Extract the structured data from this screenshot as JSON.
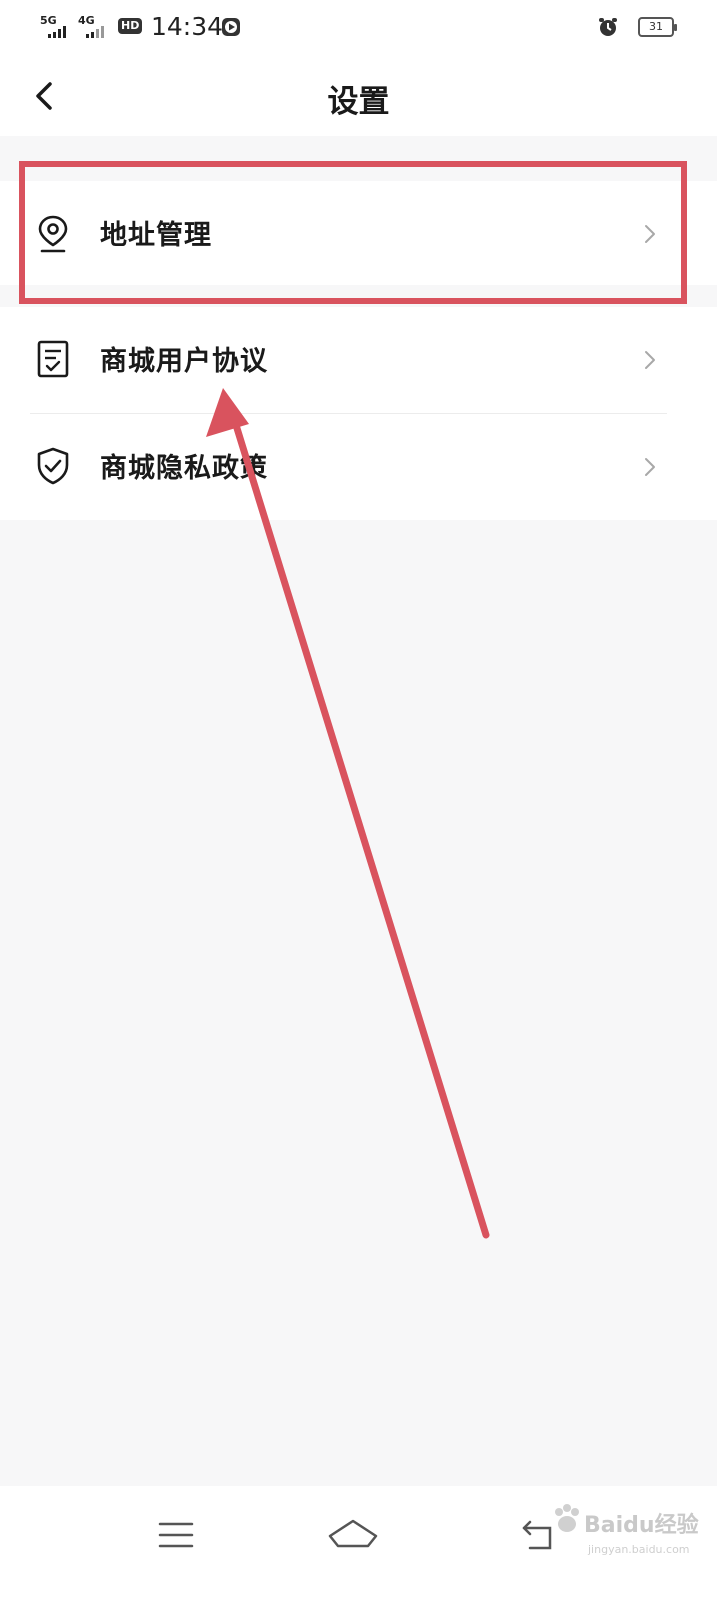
{
  "status_bar": {
    "sig1": "5G",
    "sig2": "4G",
    "hd": "HD",
    "time": "14:34",
    "battery": "31"
  },
  "header": {
    "title": "设置"
  },
  "settings": {
    "items": [
      {
        "label": "地址管理",
        "icon": "location-pin-icon"
      },
      {
        "label": "商城用户协议",
        "icon": "document-check-icon"
      },
      {
        "label": "商城隐私政策",
        "icon": "shield-check-icon"
      }
    ]
  },
  "annotation": {
    "highlight_color": "#d9535e"
  },
  "watermark": {
    "text": "Baidu经验",
    "sub": "jingyan.baidu.com"
  },
  "nav_bar": {
    "icons": [
      "menu-icon",
      "home-icon",
      "back-icon"
    ]
  }
}
